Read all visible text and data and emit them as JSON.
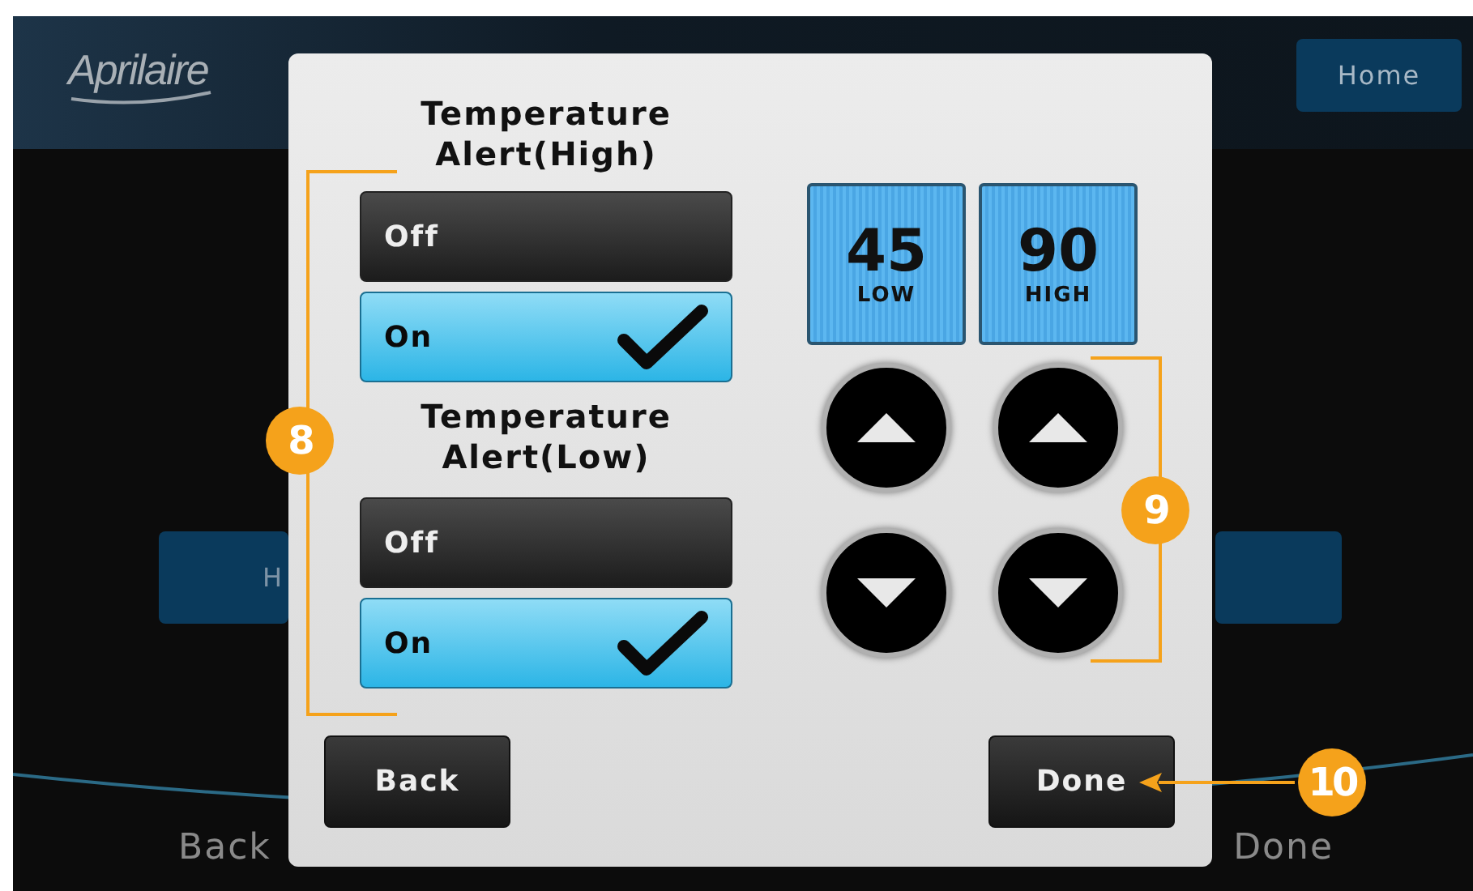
{
  "header": {
    "logo": "Aprilaire",
    "home_button": "Home"
  },
  "background": {
    "partial_button": "H",
    "footer_labels": [
      "Back",
      "Done"
    ]
  },
  "dialog": {
    "alerts": [
      {
        "title": "Temperature Alert(High)",
        "options": [
          {
            "label": "Off",
            "selected": false
          },
          {
            "label": "On",
            "selected": true
          }
        ]
      },
      {
        "title": "Temperature Alert(Low)",
        "options": [
          {
            "label": "Off",
            "selected": false
          },
          {
            "label": "On",
            "selected": true
          }
        ]
      }
    ],
    "setpoints": [
      {
        "value": "45",
        "label": "LOW"
      },
      {
        "value": "90",
        "label": "HIGH"
      }
    ],
    "buttons": [
      "Back",
      "Done"
    ]
  },
  "callouts": [
    "8",
    "9",
    "10"
  ]
}
